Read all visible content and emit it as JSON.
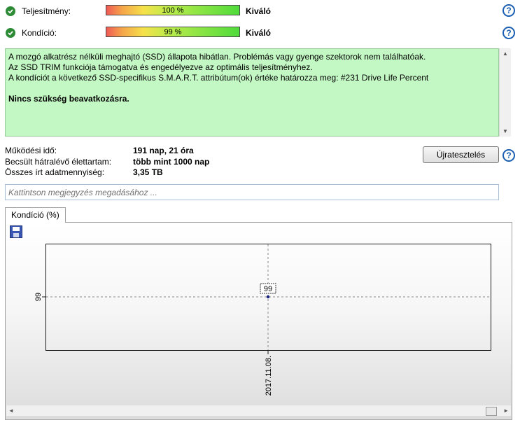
{
  "rows": [
    {
      "label": "Teljesítmény:",
      "bar_text": "100 %",
      "percent": 100,
      "rating": "Kiváló",
      "help": "?"
    },
    {
      "label": "Kondíció:",
      "bar_text": "99 %",
      "percent": 99,
      "rating": "Kiváló",
      "help": "?"
    }
  ],
  "info": {
    "lines": [
      "A mozgó alkatrész nélküli meghajtó (SSD) állapota hibátlan. Problémás vagy gyenge szektorok nem találhatóak.",
      "Az SSD TRIM funkciója támogatva és engedélyezve az optimális teljesítményhez.",
      "A kondíciót a következő SSD-specifikus S.M.A.R.T. attribútum(ok) értéke határozza meg:  #231 Drive Life Percent"
    ],
    "action": "Nincs szükség beavatkozásra."
  },
  "stats": [
    {
      "label": "Működési idő:",
      "value": "191 nap, 21 óra"
    },
    {
      "label": "Becsült hátralévő élettartam:",
      "value": "több mint 1000 nap"
    },
    {
      "label": "Összes írt adatmennyiség:",
      "value": "3,35 TB"
    }
  ],
  "retest_label": "Újratesztelés",
  "retest_help": "?",
  "note_placeholder": "Kattintson megjegyzés megadásához ...",
  "tab_label": "Kondíció  (%)",
  "chart_data": {
    "type": "line",
    "x": [
      "2017.11.08."
    ],
    "series": [
      {
        "values": [
          99
        ]
      }
    ],
    "data_labels": [
      "99"
    ],
    "ytick": "99",
    "xtick": "2017.11.08.",
    "grid": "dashed crosshair at data point"
  },
  "colors": {
    "info_bg": "#c3f7c3",
    "check": "#2e8b35",
    "help": "#1b5fb3",
    "point": "#1a237e"
  },
  "icons": {
    "check": "check-circle-icon",
    "help": "help-icon",
    "save": "save-icon"
  }
}
